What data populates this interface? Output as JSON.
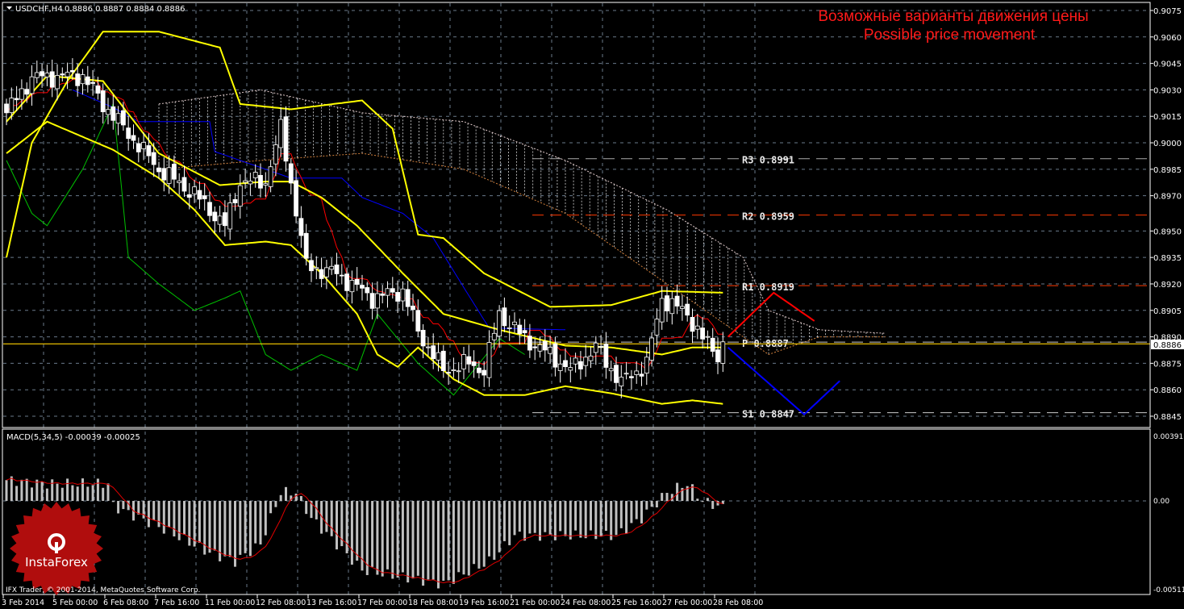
{
  "header": {
    "symbol": "USDCHF,H4",
    "ohlc": "0.8886 0.8887 0.8884 0.8886"
  },
  "annotation": {
    "line1": "Возможные варианты движения цены",
    "line2": "Possible price movement"
  },
  "copyright": "IFX Trader, © 2001-2014, MetaQuotes Software Corp.",
  "logo": {
    "text": "InstaForex"
  },
  "current_price": "0.8886",
  "colors": {
    "bands": "#ffff00",
    "tenkan": "#ff0000",
    "kijun": "#0000ff",
    "chikou": "#00c000",
    "pivot": "#ff4500",
    "up_move": "#ff0000",
    "down_move": "#0000ff",
    "grid": "#6a7a8a",
    "macd_hist": "#c0c0c0"
  },
  "chart_data": [
    {
      "type": "candlestick",
      "title": "USDCHF,H4",
      "ylim": [
        0.8838,
        0.9082
      ],
      "yticks": [
        "0.9075",
        "0.9060",
        "0.9045",
        "0.9030",
        "0.9015",
        "0.9000",
        "0.8985",
        "0.8970",
        "0.8950",
        "0.8935",
        "0.8920",
        "0.8905",
        "0.8890",
        "0.8875",
        "0.8860",
        "0.8845"
      ],
      "xticks": [
        "3 Feb 2014",
        "5 Feb 00:00",
        "6 Feb 08:00",
        "7 Feb 16:00",
        "11 Feb 00:00",
        "12 Feb 08:00",
        "13 Feb 16:00",
        "17 Feb 00:00",
        "18 Feb 08:00",
        "19 Feb 16:00",
        "21 Feb 00:00",
        "24 Feb 08:00",
        "25 Feb 16:00",
        "27 Feb 00:00",
        "28 Feb 08:00"
      ],
      "bars": 142,
      "close_keypoints": [
        [
          0,
          0.9017
        ],
        [
          5,
          0.9037
        ],
        [
          15,
          0.9038
        ],
        [
          19,
          0.9022
        ],
        [
          30,
          0.8985
        ],
        [
          37,
          0.8971
        ],
        [
          43,
          0.8953
        ],
        [
          46,
          0.8978
        ],
        [
          51,
          0.8978
        ],
        [
          54,
          0.9008
        ],
        [
          57,
          0.8962
        ],
        [
          59,
          0.893
        ],
        [
          65,
          0.8926
        ],
        [
          72,
          0.8912
        ],
        [
          78,
          0.8916
        ],
        [
          81,
          0.8893
        ],
        [
          86,
          0.8871
        ],
        [
          91,
          0.8875
        ],
        [
          94,
          0.8871
        ],
        [
          97,
          0.8903
        ],
        [
          102,
          0.8889
        ],
        [
          107,
          0.888
        ],
        [
          111,
          0.8871
        ],
        [
          116,
          0.8884
        ],
        [
          121,
          0.8864
        ],
        [
          126,
          0.8875
        ],
        [
          129,
          0.8912
        ],
        [
          134,
          0.8903
        ],
        [
          137,
          0.8889
        ],
        [
          140,
          0.888
        ],
        [
          141,
          0.8886
        ]
      ],
      "bollinger": {
        "upper": [
          [
            0,
            0.8935
          ],
          [
            5,
            0.9
          ],
          [
            12,
            0.9035
          ],
          [
            19,
            0.9063
          ],
          [
            30,
            0.9063
          ],
          [
            42,
            0.9054
          ],
          [
            46,
            0.9022
          ],
          [
            56,
            0.9019
          ],
          [
            70,
            0.9024
          ],
          [
            76,
            0.9008
          ],
          [
            81,
            0.8948
          ],
          [
            86,
            0.8946
          ],
          [
            94,
            0.8926
          ],
          [
            107,
            0.8907
          ],
          [
            119,
            0.8908
          ],
          [
            129,
            0.8916
          ],
          [
            141,
            0.8915
          ]
        ],
        "middle": [
          [
            0,
            0.9012
          ],
          [
            8,
            0.9038
          ],
          [
            19,
            0.9035
          ],
          [
            30,
            0.8994
          ],
          [
            42,
            0.8976
          ],
          [
            51,
            0.8978
          ],
          [
            56,
            0.8978
          ],
          [
            62,
            0.8969
          ],
          [
            69,
            0.8953
          ],
          [
            78,
            0.8926
          ],
          [
            86,
            0.8903
          ],
          [
            97,
            0.8894
          ],
          [
            110,
            0.8885
          ],
          [
            119,
            0.8884
          ],
          [
            129,
            0.888
          ],
          [
            135,
            0.8884
          ],
          [
            141,
            0.8884
          ]
        ],
        "lower": [
          [
            0,
            0.8994
          ],
          [
            8,
            0.9012
          ],
          [
            21,
            0.8996
          ],
          [
            30,
            0.898
          ],
          [
            37,
            0.8962
          ],
          [
            43,
            0.8942
          ],
          [
            51,
            0.8944
          ],
          [
            56,
            0.8942
          ],
          [
            62,
            0.8926
          ],
          [
            69,
            0.8903
          ],
          [
            73,
            0.888
          ],
          [
            77,
            0.8873
          ],
          [
            81,
            0.8884
          ],
          [
            88,
            0.8866
          ],
          [
            94,
            0.8857
          ],
          [
            102,
            0.8857
          ],
          [
            110,
            0.8862
          ],
          [
            119,
            0.8858
          ],
          [
            129,
            0.8852
          ],
          [
            135,
            0.8854
          ],
          [
            141,
            0.8852
          ]
        ]
      },
      "ichimoku": {
        "span_top": [
          [
            30,
            0.9022
          ],
          [
            50,
            0.903
          ],
          [
            70,
            0.9017
          ],
          [
            90,
            0.9012
          ],
          [
            110,
            0.899
          ],
          [
            130,
            0.8962
          ],
          [
            145,
            0.8935
          ],
          [
            150,
            0.8905
          ],
          [
            160,
            0.8894
          ],
          [
            173,
            0.8892
          ]
        ],
        "span_bottom": [
          [
            30,
            0.8985
          ],
          [
            50,
            0.899
          ],
          [
            70,
            0.8994
          ],
          [
            90,
            0.8985
          ],
          [
            110,
            0.896
          ],
          [
            125,
            0.893
          ],
          [
            135,
            0.891
          ],
          [
            145,
            0.889
          ],
          [
            150,
            0.888
          ],
          [
            160,
            0.889
          ],
          [
            173,
            0.889
          ]
        ],
        "kijun": [
          [
            13,
            0.903
          ],
          [
            21,
            0.902
          ],
          [
            26,
            0.9012
          ],
          [
            40,
            0.9012
          ],
          [
            41,
            0.8995
          ],
          [
            56,
            0.898
          ],
          [
            66,
            0.898
          ],
          [
            70,
            0.8969
          ],
          [
            78,
            0.896
          ],
          [
            84,
            0.8946
          ],
          [
            90,
            0.8918
          ],
          [
            95,
            0.8895
          ],
          [
            110,
            0.8894
          ]
        ],
        "chikou": [
          [
            0,
            0.899
          ],
          [
            5,
            0.896
          ],
          [
            8,
            0.8953
          ],
          [
            15,
            0.8985
          ],
          [
            21,
            0.9022
          ],
          [
            24,
            0.8935
          ],
          [
            30,
            0.892
          ],
          [
            37,
            0.8905
          ],
          [
            43,
            0.8912
          ],
          [
            46,
            0.8916
          ],
          [
            51,
            0.888
          ],
          [
            56,
            0.8871
          ],
          [
            62,
            0.888
          ],
          [
            69,
            0.8871
          ],
          [
            73,
            0.8903
          ],
          [
            81,
            0.8875
          ],
          [
            88,
            0.8857
          ],
          [
            97,
            0.8889
          ],
          [
            102,
            0.888
          ]
        ]
      },
      "pivots": [
        {
          "label": "R3",
          "value": "0.8991"
        },
        {
          "label": "R2",
          "value": "0.8959"
        },
        {
          "label": "R1",
          "value": "0.8919"
        },
        {
          "label": "P",
          "value": "0.8887"
        },
        {
          "label": "S1",
          "value": "0.8847"
        }
      ],
      "scenarios": {
        "up": [
          [
            142,
            0.889
          ],
          [
            151,
            0.8915
          ],
          [
            159,
            0.8899
          ]
        ],
        "down": [
          [
            142,
            0.8884
          ],
          [
            157,
            0.8846
          ],
          [
            164,
            0.8865
          ]
        ]
      }
    },
    {
      "type": "bar",
      "title": "MACD(5,34,5) -0.00039 -0.00025",
      "ylim": [
        -0.00511,
        0.00391
      ],
      "yticks": [
        "0.00391",
        "0.00",
        "-0.00511"
      ],
      "hist_keypoints": [
        [
          0,
          0.0012
        ],
        [
          8,
          0.001
        ],
        [
          20,
          0.001
        ],
        [
          21,
          -0.0003
        ],
        [
          30,
          -0.0015
        ],
        [
          40,
          -0.003
        ],
        [
          45,
          -0.0035
        ],
        [
          50,
          -0.0025
        ],
        [
          54,
          0.0005
        ],
        [
          57,
          0.0005
        ],
        [
          60,
          -0.001
        ],
        [
          70,
          -0.004
        ],
        [
          80,
          -0.0045
        ],
        [
          86,
          -0.0048
        ],
        [
          95,
          -0.0035
        ],
        [
          100,
          -0.002
        ],
        [
          110,
          -0.002
        ],
        [
          120,
          -0.002
        ],
        [
          125,
          -0.001
        ],
        [
          130,
          0.0005
        ],
        [
          134,
          0.001
        ],
        [
          137,
          0.0
        ],
        [
          141,
          -0.0004
        ]
      ]
    }
  ]
}
